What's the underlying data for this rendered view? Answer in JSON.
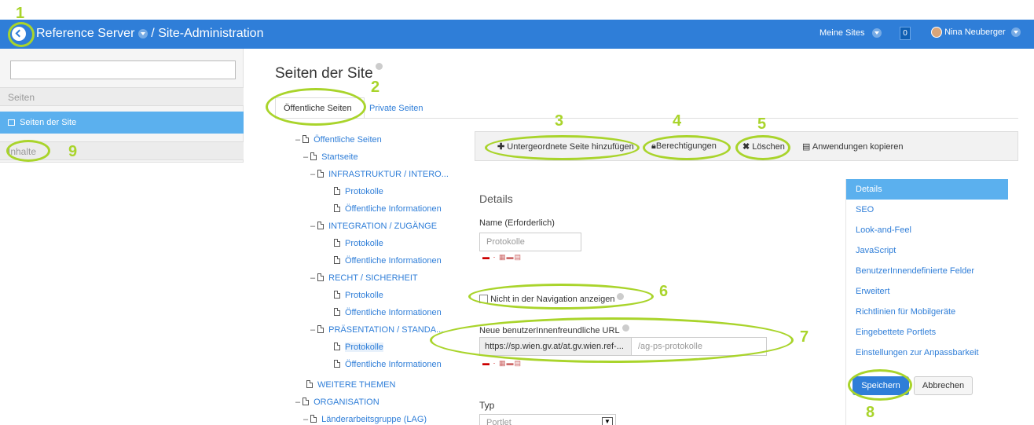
{
  "topbar": {
    "title": "Reference Server",
    "subtitle": "/ Site-Administration",
    "my_sites": "Meine Sites",
    "notif_count": "0",
    "user_name": "Nina Neuberger"
  },
  "sidebar": {
    "search_value": "",
    "section_pages": "Seiten",
    "active_item": "Seiten der Site",
    "section_content": "Inhalte"
  },
  "main": {
    "page_title": "Seiten der Site",
    "tabs": [
      "Öffentliche Seiten",
      "Private Seiten"
    ],
    "tree": [
      {
        "label": "Öffentliche Seiten",
        "minus": true
      },
      {
        "label": "Startseite",
        "minus": true
      },
      {
        "label": "INFRASTRUKTUR / INTERO...",
        "minus": true
      },
      {
        "label": "Protokolle",
        "minus": false
      },
      {
        "label": "Öffentliche Informationen",
        "minus": false
      },
      {
        "label": "INTEGRATION / ZUGÄNGE",
        "minus": true
      },
      {
        "label": "Protokolle",
        "minus": false
      },
      {
        "label": "Öffentliche Informationen",
        "minus": false
      },
      {
        "label": "RECHT / SICHERHEIT",
        "minus": true
      },
      {
        "label": "Protokolle",
        "minus": false
      },
      {
        "label": "Öffentliche Informationen",
        "minus": false
      },
      {
        "label": "PRÄSENTATION / STANDA...",
        "minus": true
      },
      {
        "label": "Protokolle",
        "minus": false
      },
      {
        "label": "Öffentliche Informationen",
        "minus": false
      },
      {
        "label": "WEITERE THEMEN",
        "minus": false
      },
      {
        "label": "ORGANISATION",
        "minus": true
      },
      {
        "label": "Länderarbeitsgruppe (LAG)",
        "minus": true
      }
    ],
    "toolbar": {
      "add_child": "Untergeordnete Seite hinzufügen",
      "permissions": "Berechtigungen",
      "delete": "Löschen",
      "copy_apps": "Anwendungen kopieren"
    },
    "details": {
      "heading": "Details",
      "name_label": "Name (Erforderlich)",
      "name_value": "Protokolle",
      "hide_nav_label": "Nicht in der Navigation anzeigen",
      "friendly_url_label": "Neue benutzerInnenfreundliche URL",
      "friendly_url_prefix": "https://sp.wien.gv.at/at.gv.wien.ref-...",
      "friendly_url_value": "/ag-ps-protokolle",
      "type_label": "Typ",
      "type_value": "Portlet"
    }
  },
  "rightnav": {
    "items": [
      "Details",
      "SEO",
      "Look-and-Feel",
      "JavaScript",
      "BenutzerInnendefinierte Felder",
      "Erweitert",
      "Richtlinien für Mobilgeräte",
      "Eingebettete Portlets",
      "Einstellungen zur Anpassbarkeit"
    ],
    "save": "Speichern",
    "cancel": "Abbrechen"
  },
  "annotations": [
    "1",
    "2",
    "3",
    "4",
    "5",
    "6",
    "7",
    "8",
    "9"
  ],
  "colors": {
    "accent": "#2f7ed8",
    "active": "#5bb0ee",
    "annotation": "#a9d42b"
  }
}
